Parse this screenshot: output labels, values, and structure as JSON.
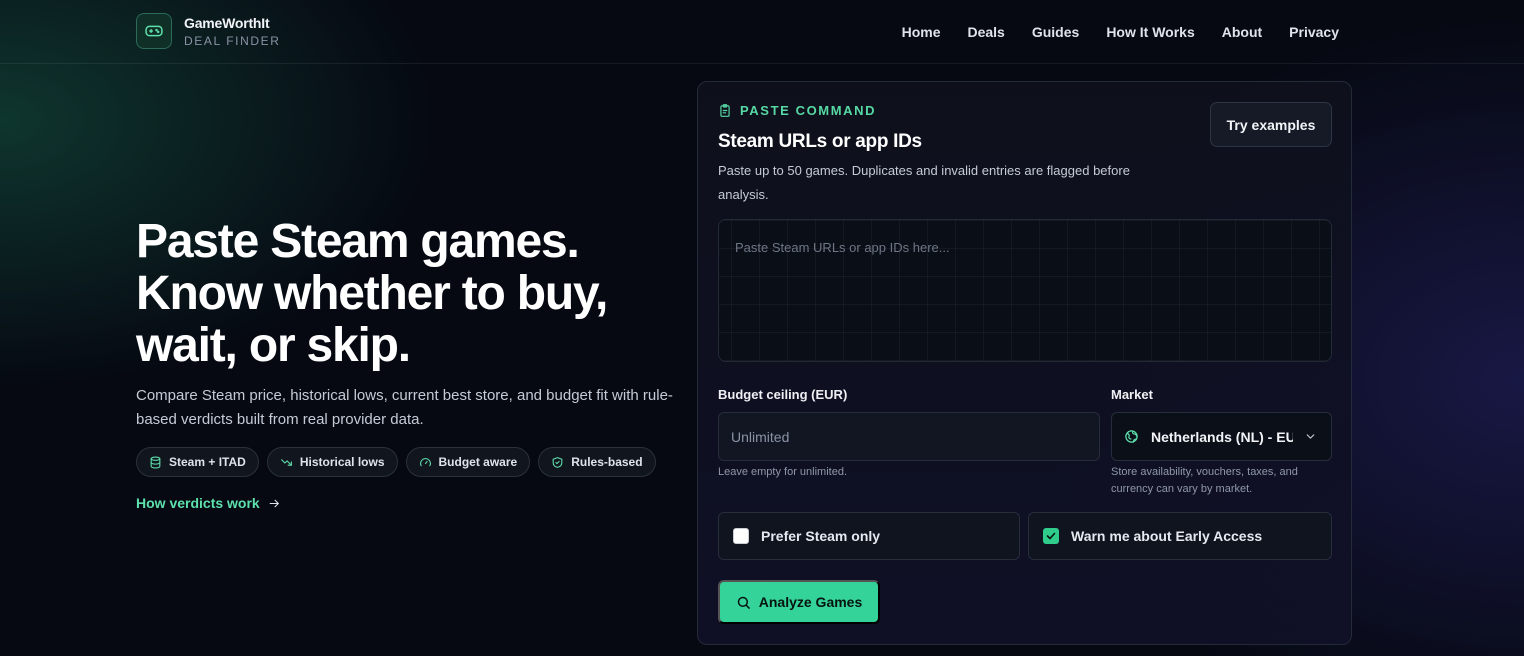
{
  "brand": {
    "name": "GameWorthIt",
    "subtitle": "DEAL FINDER",
    "icon": "gamepad-icon"
  },
  "nav": [
    {
      "label": "Home"
    },
    {
      "label": "Deals"
    },
    {
      "label": "Guides"
    },
    {
      "label": "How It Works"
    },
    {
      "label": "About"
    },
    {
      "label": "Privacy"
    }
  ],
  "hero": {
    "title_lines": [
      "Paste Steam games.",
      "Know whether to buy,",
      "wait, or skip."
    ],
    "description": "Compare Steam price, historical lows, current best store, and budget fit with rule-based verdicts built from real provider data.",
    "chips": [
      {
        "label": "Steam + ITAD",
        "icon": "database-icon"
      },
      {
        "label": "Historical lows",
        "icon": "trending-down-icon"
      },
      {
        "label": "Budget aware",
        "icon": "gauge-icon"
      },
      {
        "label": "Rules-based",
        "icon": "shield-check-icon"
      }
    ],
    "link": "How verdicts work"
  },
  "card": {
    "eyebrow": "PASTE COMMAND",
    "title": "Steam URLs or app IDs",
    "description": "Paste up to 50 games. Duplicates and invalid entries are flagged before analysis.",
    "try_examples": "Try examples",
    "textarea_placeholder": "Paste Steam URLs or app IDs here...",
    "budget": {
      "label": "Budget ceiling (EUR)",
      "placeholder": "Unlimited",
      "hint": "Leave empty for unlimited."
    },
    "market": {
      "label": "Market",
      "value": "Netherlands (NL) - EUR",
      "hint": "Store availability, vouchers, taxes, and currency can vary by market."
    },
    "checkboxes": {
      "prefer_steam": {
        "label": "Prefer Steam only",
        "checked": false
      },
      "early_access": {
        "label": "Warn me about Early Access",
        "checked": true
      }
    },
    "analyze": "Analyze Games"
  },
  "colors": {
    "accent": "#34d399",
    "accent_text": "#56d9a4",
    "background": "#060912",
    "card_border": "#232a38"
  }
}
